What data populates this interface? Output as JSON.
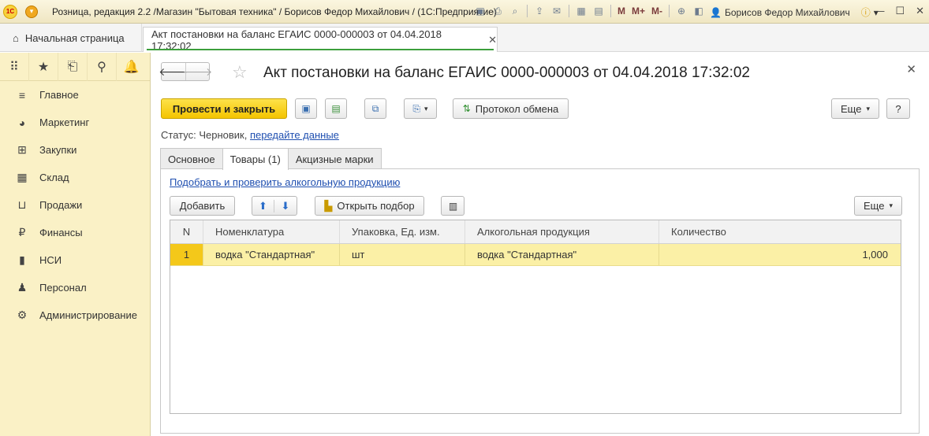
{
  "window": {
    "title": "Розница, редакция 2.2 /Магазин \"Бытовая техника\" / Борисов Федор Михайлович /  (1С:Предприятие)",
    "user": "Борисов Федор Михайлович",
    "toolbar_text": {
      "m": "M",
      "m_plus": "M+",
      "m_minus": "M-"
    }
  },
  "tabs": {
    "home": "Начальная страница",
    "document": "Акт постановки на баланс ЕГАИС 0000-000003 от 04.04.2018 17:32:02"
  },
  "sidebar": {
    "items": [
      {
        "label": "Главное",
        "icon": "menu-lines-icon"
      },
      {
        "label": "Маркетинг",
        "icon": "pie-chart-icon"
      },
      {
        "label": "Закупки",
        "icon": "cart-icon"
      },
      {
        "label": "Склад",
        "icon": "warehouse-icon"
      },
      {
        "label": "Продажи",
        "icon": "basket-icon"
      },
      {
        "label": "Финансы",
        "icon": "ruble-icon"
      },
      {
        "label": "НСИ",
        "icon": "book-icon"
      },
      {
        "label": "Персонал",
        "icon": "person-icon"
      },
      {
        "label": "Администрирование",
        "icon": "gear-icon"
      }
    ]
  },
  "document": {
    "title": "Акт постановки на баланс ЕГАИС 0000-000003 от 04.04.2018 17:32:02",
    "buttons": {
      "post_and_close": "Провести и закрыть",
      "exchange_log": "Протокол обмена",
      "more": "Еще",
      "help": "?"
    },
    "status_label": "Статус:",
    "status_value": "Черновик,",
    "status_link": "передайте данные",
    "form_tabs": [
      "Основное",
      "Товары (1)",
      "Акцизные марки"
    ],
    "active_tab": "Товары (1)"
  },
  "goods": {
    "pick_link": "Подобрать и проверить алкогольную продукцию",
    "buttons": {
      "add": "Добавить",
      "open_selection": "Открыть подбор",
      "more": "Еще"
    },
    "columns": [
      "N",
      "Номенклатура",
      "Упаковка, Ед. изм.",
      "Алкогольная продукция",
      "Количество"
    ],
    "rows": [
      {
        "n": "1",
        "nomenclature": "водка \"Стандартная\"",
        "unit": "шт",
        "alcohol": "водка \"Стандартная\"",
        "qty": "1,000"
      }
    ]
  },
  "colors": {
    "sidebar_bg": "#faf1c6",
    "primary_button": "#f4c400",
    "selected_row": "#fbf0a6",
    "link": "#1f4fb0"
  }
}
